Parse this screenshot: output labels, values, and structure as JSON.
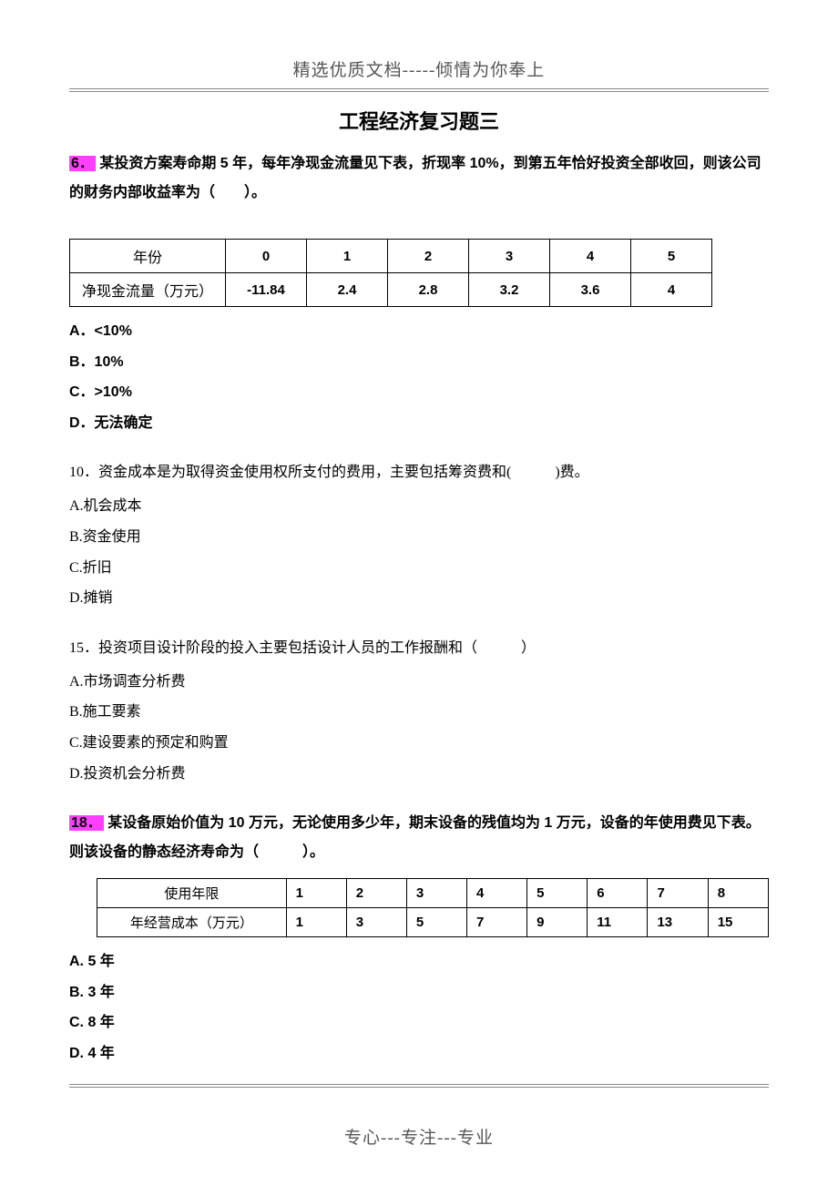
{
  "header": "精选优质文档-----倾情为你奉上",
  "title": "工程经济复习题三",
  "q6": {
    "num": "6．",
    "text_a": "某投资方案寿命期 5 年，每年净现金流量见下表，折现率 10%，到第五年恰好投资全部收回，则该公司的财务内部收益率为（　　）。",
    "table": {
      "row1": [
        "年份",
        "0",
        "1",
        "2",
        "3",
        "4",
        "5"
      ],
      "row2": [
        "净现金流量（万元）",
        "-11.84",
        "2.4",
        "2.8",
        "3.2",
        "3.6",
        "4"
      ]
    },
    "opts": [
      "A．<10%",
      "B．10%",
      "C．>10%",
      "D．无法确定"
    ]
  },
  "q10": {
    "text": "10．资金成本是为取得资金使用权所支付的费用，主要包括筹资费和(　　　)费。",
    "opts": [
      "A.机会成本",
      "B.资金使用",
      "C.折旧",
      "D.摊销"
    ]
  },
  "q15": {
    "text": "15．投资项目设计阶段的投入主要包括设计人员的工作报酬和（　　　）",
    "opts": [
      "A.市场调查分析费",
      "B.施工要素",
      "C.建设要素的预定和购置",
      "D.投资机会分析费"
    ]
  },
  "q18": {
    "num": "18．",
    "text_a": "某设备原始价值为 10 万元，无论使用多少年，期末设备的残值均为 1 万元，设备的年使用费见下表。则该设备的静态经济寿命为（　　　）。",
    "table": {
      "row1": [
        "使用年限",
        "1",
        "2",
        "3",
        "4",
        "5",
        "6",
        "7",
        "8"
      ],
      "row2": [
        "年经营成本（万元）",
        "1",
        "3",
        "5",
        "7",
        "9",
        "11",
        "13",
        "15"
      ]
    },
    "opts": [
      "A. 5 年",
      "B. 3 年",
      "C. 8 年",
      "D. 4 年"
    ]
  },
  "footer": "专心---专注---专业"
}
